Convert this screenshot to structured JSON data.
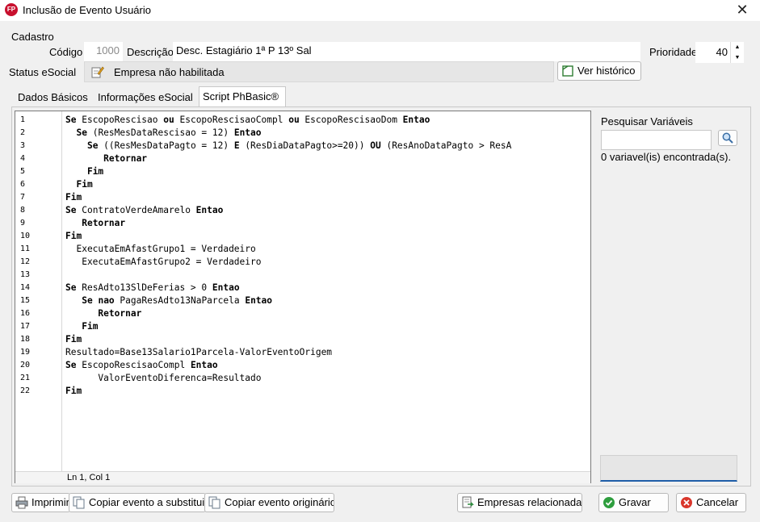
{
  "window": {
    "app_icon_text": "FP",
    "title": "Inclusão de Evento Usuário",
    "close_glyph": "✕"
  },
  "cadastro": {
    "group_label": "Cadastro",
    "codigo_label": "Código",
    "codigo_value": "1000",
    "descricao_label": "Descrição",
    "descricao_value": "Desc. Estagiário 1ª P 13º Sal",
    "prioridade_label": "Prioridade",
    "prioridade_value": "40",
    "status_label": "Status eSocial",
    "status_value": "Empresa não habilitada",
    "ver_historico_label": "Ver histórico"
  },
  "tabs": [
    {
      "label": "Dados Básicos",
      "active": false
    },
    {
      "label": "Informações eSocial",
      "active": false
    },
    {
      "label": "Script PhBasic®",
      "active": true
    }
  ],
  "editor": {
    "line_numbers": [
      "1",
      "2",
      "3",
      "4",
      "5",
      "6",
      "7",
      "8",
      "9",
      "10",
      "11",
      "12",
      "13",
      "14",
      "15",
      "16",
      "17",
      "18",
      "19",
      "20",
      "21",
      "22"
    ],
    "lines": [
      "Se EscopoRescisao ou EscopoRescisaoCompl ou EscopoRescisaoDom Entao",
      "  Se (ResMesDataRescisao = 12) Entao",
      "    Se ((ResMesDataPagto = 12) E (ResDiaDataPagto>=20)) OU (ResAnoDataPagto > ResA",
      "       Retornar",
      "    Fim",
      "  Fim",
      "Fim",
      "Se ContratoVerdeAmarelo Entao",
      "   Retornar",
      "Fim",
      "  ExecutaEmAfastGrupo1 = Verdadeiro",
      "   ExecutaEmAfastGrupo2 = Verdadeiro",
      "",
      "Se ResAdto13SlDeFerias > 0 Entao",
      "   Se nao PagaResAdto13NaParcela Entao",
      "      Retornar",
      "   Fim",
      "Fim",
      "Resultado=Base13Salario1Parcela-ValorEventoOrigem",
      "Se EscopoRescisaoCompl Entao",
      "      ValorEventoDiferenca=Resultado",
      "Fim"
    ],
    "cursor_status": "Ln 1, Col 1"
  },
  "variables": {
    "search_label": "Pesquisar Variáveis",
    "search_value": "",
    "found_text": "0 variavel(is) encontrada(s)."
  },
  "footer": {
    "imprimir_label": "Imprimir",
    "copiar_substituto_label": "Copiar evento a substituir",
    "copiar_original_label": "Copiar evento originário",
    "empresas_label": "Empresas relacionadas",
    "gravar_label": "Gravar",
    "cancelar_label": "Cancelar"
  },
  "colors": {
    "app_icon": "#c8102e",
    "gravar_icon": "#2e9e3e",
    "cancelar_icon": "#d9362b"
  }
}
